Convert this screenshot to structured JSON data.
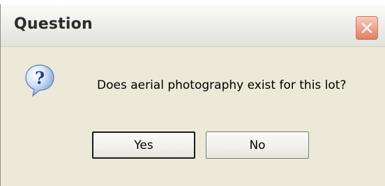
{
  "window": {
    "title": "Question",
    "close_icon": "close-icon"
  },
  "dialog": {
    "icon": "question-icon",
    "message": "Does aerial photography exist for this lot?"
  },
  "buttons": {
    "yes_label": "Yes",
    "no_label": "No"
  },
  "colors": {
    "dialog_background": "#ece9d8",
    "close_button": "#e07e63",
    "question_icon": "#3a5fc4"
  }
}
